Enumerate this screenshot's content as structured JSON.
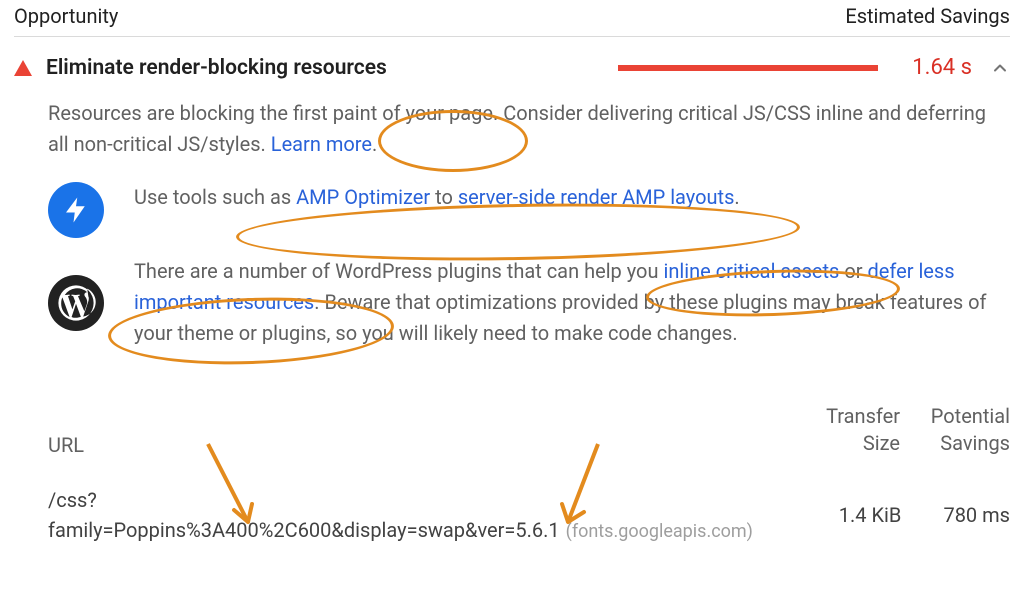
{
  "header": {
    "left": "Opportunity",
    "right": "Estimated Savings"
  },
  "item": {
    "title": "Eliminate render-blocking resources",
    "savings": "1.64 s",
    "desc_prefix": "Resources are blocking the first paint of your page. Consider delivering critical JS/CSS inline and deferring all non-critical JS/styles. ",
    "learn_more": "Learn more",
    "period": "."
  },
  "amp": {
    "prefix": "Use tools such as ",
    "link1": "AMP Optimizer",
    "mid": " to ",
    "link2": "server-side render AMP layouts",
    "suffix": "."
  },
  "wp": {
    "prefix": "There are a number of WordPress plugins that can help you ",
    "link1": "inline critical assets",
    "mid": " or ",
    "link2": "defer less important resources",
    "suffix": ". Beware that optimizations provided by these plugins may break features of your theme or plugins, so you will likely need to make code changes."
  },
  "table": {
    "url_label": "URL",
    "transfer_label_l1": "Transfer",
    "transfer_label_l2": "Size",
    "savings_label_l1": "Potential",
    "savings_label_l2": "Savings",
    "rows": [
      {
        "url": "/css?family=Poppins%3A400%2C600&display=swap&ver=5.6.1",
        "host": "(fonts.googleapis.com)",
        "transfer": "1.4 KiB",
        "savings": "780 ms"
      }
    ]
  }
}
